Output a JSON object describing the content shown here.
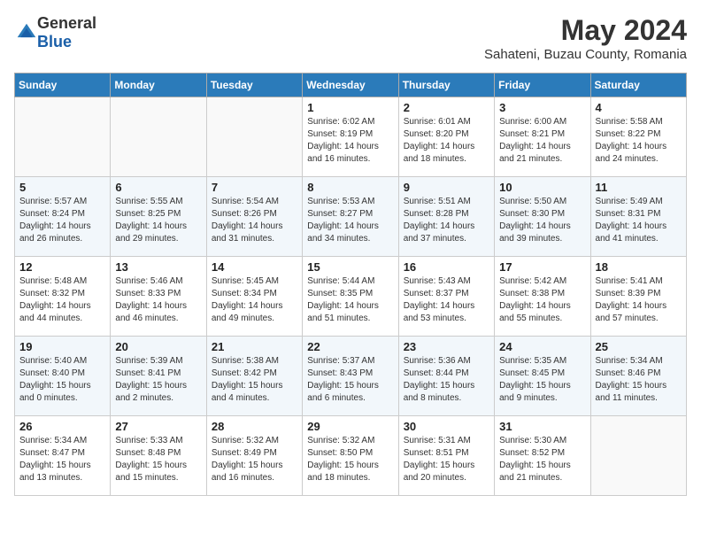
{
  "header": {
    "logo_general": "General",
    "logo_blue": "Blue",
    "month_title": "May 2024",
    "location": "Sahateni, Buzau County, Romania"
  },
  "days_of_week": [
    "Sunday",
    "Monday",
    "Tuesday",
    "Wednesday",
    "Thursday",
    "Friday",
    "Saturday"
  ],
  "weeks": [
    [
      {
        "day": "",
        "detail": ""
      },
      {
        "day": "",
        "detail": ""
      },
      {
        "day": "",
        "detail": ""
      },
      {
        "day": "1",
        "detail": "Sunrise: 6:02 AM\nSunset: 8:19 PM\nDaylight: 14 hours\nand 16 minutes."
      },
      {
        "day": "2",
        "detail": "Sunrise: 6:01 AM\nSunset: 8:20 PM\nDaylight: 14 hours\nand 18 minutes."
      },
      {
        "day": "3",
        "detail": "Sunrise: 6:00 AM\nSunset: 8:21 PM\nDaylight: 14 hours\nand 21 minutes."
      },
      {
        "day": "4",
        "detail": "Sunrise: 5:58 AM\nSunset: 8:22 PM\nDaylight: 14 hours\nand 24 minutes."
      }
    ],
    [
      {
        "day": "5",
        "detail": "Sunrise: 5:57 AM\nSunset: 8:24 PM\nDaylight: 14 hours\nand 26 minutes."
      },
      {
        "day": "6",
        "detail": "Sunrise: 5:55 AM\nSunset: 8:25 PM\nDaylight: 14 hours\nand 29 minutes."
      },
      {
        "day": "7",
        "detail": "Sunrise: 5:54 AM\nSunset: 8:26 PM\nDaylight: 14 hours\nand 31 minutes."
      },
      {
        "day": "8",
        "detail": "Sunrise: 5:53 AM\nSunset: 8:27 PM\nDaylight: 14 hours\nand 34 minutes."
      },
      {
        "day": "9",
        "detail": "Sunrise: 5:51 AM\nSunset: 8:28 PM\nDaylight: 14 hours\nand 37 minutes."
      },
      {
        "day": "10",
        "detail": "Sunrise: 5:50 AM\nSunset: 8:30 PM\nDaylight: 14 hours\nand 39 minutes."
      },
      {
        "day": "11",
        "detail": "Sunrise: 5:49 AM\nSunset: 8:31 PM\nDaylight: 14 hours\nand 41 minutes."
      }
    ],
    [
      {
        "day": "12",
        "detail": "Sunrise: 5:48 AM\nSunset: 8:32 PM\nDaylight: 14 hours\nand 44 minutes."
      },
      {
        "day": "13",
        "detail": "Sunrise: 5:46 AM\nSunset: 8:33 PM\nDaylight: 14 hours\nand 46 minutes."
      },
      {
        "day": "14",
        "detail": "Sunrise: 5:45 AM\nSunset: 8:34 PM\nDaylight: 14 hours\nand 49 minutes."
      },
      {
        "day": "15",
        "detail": "Sunrise: 5:44 AM\nSunset: 8:35 PM\nDaylight: 14 hours\nand 51 minutes."
      },
      {
        "day": "16",
        "detail": "Sunrise: 5:43 AM\nSunset: 8:37 PM\nDaylight: 14 hours\nand 53 minutes."
      },
      {
        "day": "17",
        "detail": "Sunrise: 5:42 AM\nSunset: 8:38 PM\nDaylight: 14 hours\nand 55 minutes."
      },
      {
        "day": "18",
        "detail": "Sunrise: 5:41 AM\nSunset: 8:39 PM\nDaylight: 14 hours\nand 57 minutes."
      }
    ],
    [
      {
        "day": "19",
        "detail": "Sunrise: 5:40 AM\nSunset: 8:40 PM\nDaylight: 15 hours\nand 0 minutes."
      },
      {
        "day": "20",
        "detail": "Sunrise: 5:39 AM\nSunset: 8:41 PM\nDaylight: 15 hours\nand 2 minutes."
      },
      {
        "day": "21",
        "detail": "Sunrise: 5:38 AM\nSunset: 8:42 PM\nDaylight: 15 hours\nand 4 minutes."
      },
      {
        "day": "22",
        "detail": "Sunrise: 5:37 AM\nSunset: 8:43 PM\nDaylight: 15 hours\nand 6 minutes."
      },
      {
        "day": "23",
        "detail": "Sunrise: 5:36 AM\nSunset: 8:44 PM\nDaylight: 15 hours\nand 8 minutes."
      },
      {
        "day": "24",
        "detail": "Sunrise: 5:35 AM\nSunset: 8:45 PM\nDaylight: 15 hours\nand 9 minutes."
      },
      {
        "day": "25",
        "detail": "Sunrise: 5:34 AM\nSunset: 8:46 PM\nDaylight: 15 hours\nand 11 minutes."
      }
    ],
    [
      {
        "day": "26",
        "detail": "Sunrise: 5:34 AM\nSunset: 8:47 PM\nDaylight: 15 hours\nand 13 minutes."
      },
      {
        "day": "27",
        "detail": "Sunrise: 5:33 AM\nSunset: 8:48 PM\nDaylight: 15 hours\nand 15 minutes."
      },
      {
        "day": "28",
        "detail": "Sunrise: 5:32 AM\nSunset: 8:49 PM\nDaylight: 15 hours\nand 16 minutes."
      },
      {
        "day": "29",
        "detail": "Sunrise: 5:32 AM\nSunset: 8:50 PM\nDaylight: 15 hours\nand 18 minutes."
      },
      {
        "day": "30",
        "detail": "Sunrise: 5:31 AM\nSunset: 8:51 PM\nDaylight: 15 hours\nand 20 minutes."
      },
      {
        "day": "31",
        "detail": "Sunrise: 5:30 AM\nSunset: 8:52 PM\nDaylight: 15 hours\nand 21 minutes."
      },
      {
        "day": "",
        "detail": ""
      }
    ]
  ]
}
